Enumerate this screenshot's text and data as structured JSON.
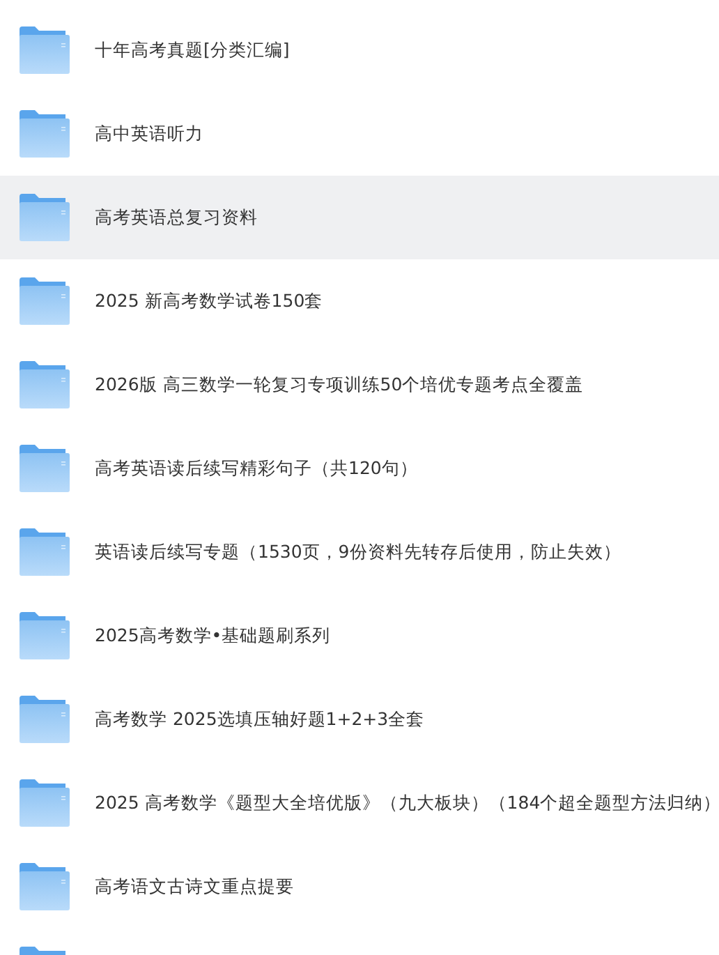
{
  "folders": [
    {
      "name": "十年高考真题[分类汇编]",
      "selected": false
    },
    {
      "name": "高中英语听力",
      "selected": false
    },
    {
      "name": "高考英语总复习资料",
      "selected": true
    },
    {
      "name": "2025 新高考数学试卷150套",
      "selected": false
    },
    {
      "name": "2026版 高三数学一轮复习专项训练50个培优专题考点全覆盖",
      "selected": false
    },
    {
      "name": "高考英语读后续写精彩句子（共120句）",
      "selected": false
    },
    {
      "name": "英语读后续写专题（1530页，9份资料先转存后使用，防止失效）",
      "selected": false
    },
    {
      "name": "2025高考数学•基础题刷系列",
      "selected": false
    },
    {
      "name": "高考数学 2025选填压轴好题1+2+3全套",
      "selected": false
    },
    {
      "name": "2025 高考数学《题型大全培优版》（九大板块）（184个超全题型方法归纳）",
      "selected": false
    },
    {
      "name": "高考语文古诗文重点提要",
      "selected": false
    },
    {
      "selected": false
    }
  ]
}
